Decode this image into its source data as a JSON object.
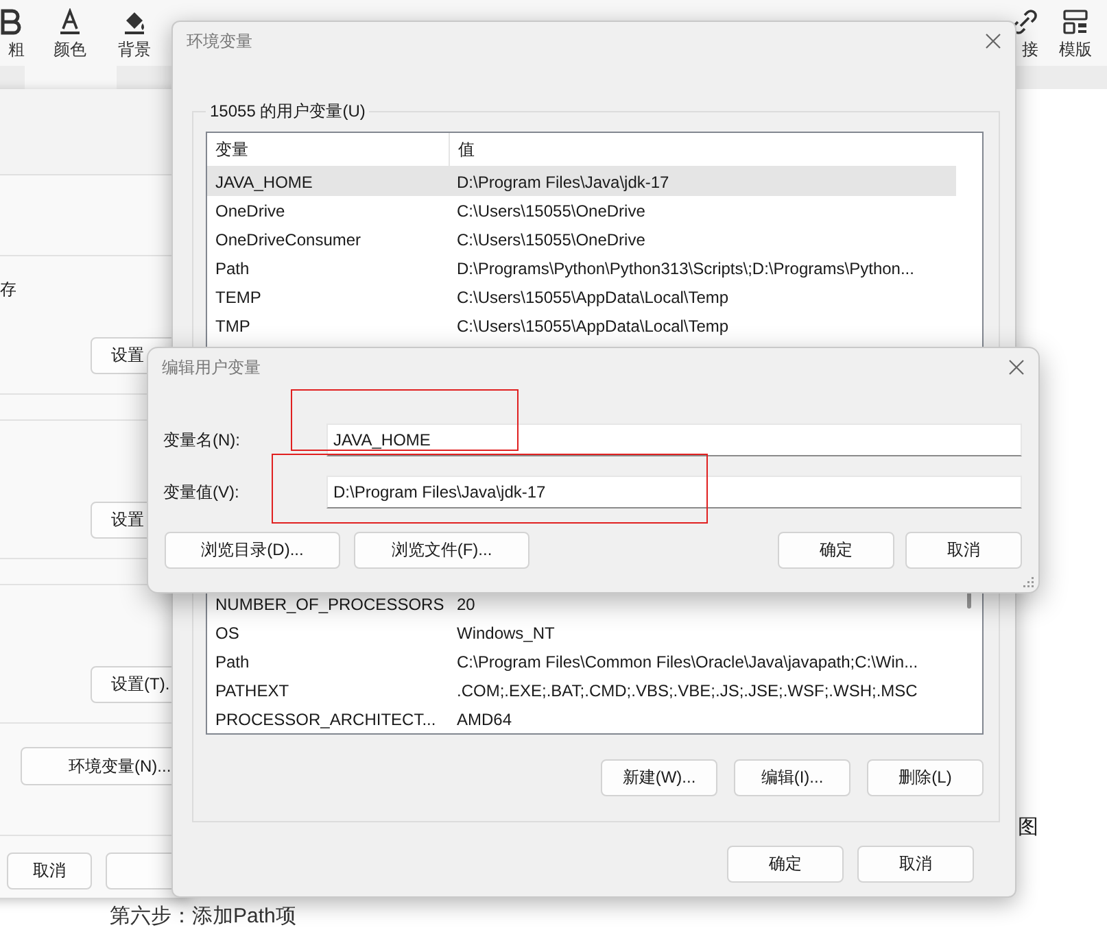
{
  "editor": {
    "toolbar": [
      {
        "kind": "bold",
        "label": "粗"
      },
      {
        "kind": "color",
        "label": "颜色"
      },
      {
        "kind": "background",
        "label": "背景"
      },
      {
        "kind": "link",
        "label": "接"
      },
      {
        "kind": "template",
        "label": "模版"
      }
    ],
    "side_text": "图",
    "step_text": "第六步：添加Path项"
  },
  "system_properties": {
    "sections": [
      {
        "text": "存",
        "button": "设置"
      },
      {
        "button": "设置"
      },
      {
        "button": "设置(T)."
      }
    ],
    "env_button": "环境变量(N)...",
    "buttons": [
      "取消"
    ]
  },
  "env_dialog": {
    "title": "环境变量",
    "user_group": {
      "legend": "15055 的用户变量(U)",
      "columns": [
        "变量",
        "值"
      ],
      "rows": [
        {
          "name": "JAVA_HOME",
          "value": "D:\\Program Files\\Java\\jdk-17",
          "selected": true
        },
        {
          "name": "OneDrive",
          "value": "C:\\Users\\15055\\OneDrive",
          "selected": false
        },
        {
          "name": "OneDriveConsumer",
          "value": "C:\\Users\\15055\\OneDrive",
          "selected": false
        },
        {
          "name": "Path",
          "value": "D:\\Programs\\Python\\Python313\\Scripts\\;D:\\Programs\\Python...",
          "selected": false
        },
        {
          "name": "TEMP",
          "value": "C:\\Users\\15055\\AppData\\Local\\Temp",
          "selected": false
        },
        {
          "name": "TMP",
          "value": "C:\\Users\\15055\\AppData\\Local\\Temp",
          "selected": false
        }
      ]
    },
    "system_group": {
      "rows": [
        {
          "name": "NUMBER_OF_PROCESSORS",
          "value": "20",
          "selected": false
        },
        {
          "name": "OS",
          "value": "Windows_NT",
          "selected": false
        },
        {
          "name": "Path",
          "value": "C:\\Program Files\\Common Files\\Oracle\\Java\\javapath;C:\\Win...",
          "selected": false
        },
        {
          "name": "PATHEXT",
          "value": ".COM;.EXE;.BAT;.CMD;.VBS;.VBE;.JS;.JSE;.WSF;.WSH;.MSC",
          "selected": false
        },
        {
          "name": "PROCESSOR_ARCHITECT...",
          "value": "AMD64",
          "selected": false
        }
      ],
      "buttons": [
        "新建(W)...",
        "编辑(I)...",
        "删除(L)"
      ]
    },
    "buttons": [
      "确定",
      "取消"
    ]
  },
  "edit_dialog": {
    "title": "编辑用户变量",
    "fields": [
      {
        "label": "变量名(N):",
        "value": "JAVA_HOME"
      },
      {
        "label": "变量值(V):",
        "value": "D:\\Program Files\\Java\\jdk-17"
      }
    ],
    "buttons": [
      "浏览目录(D)...",
      "浏览文件(F)...",
      "确定",
      "取消"
    ]
  },
  "annotations": [
    {
      "kind": "frame"
    },
    {
      "kind": "frame"
    }
  ]
}
